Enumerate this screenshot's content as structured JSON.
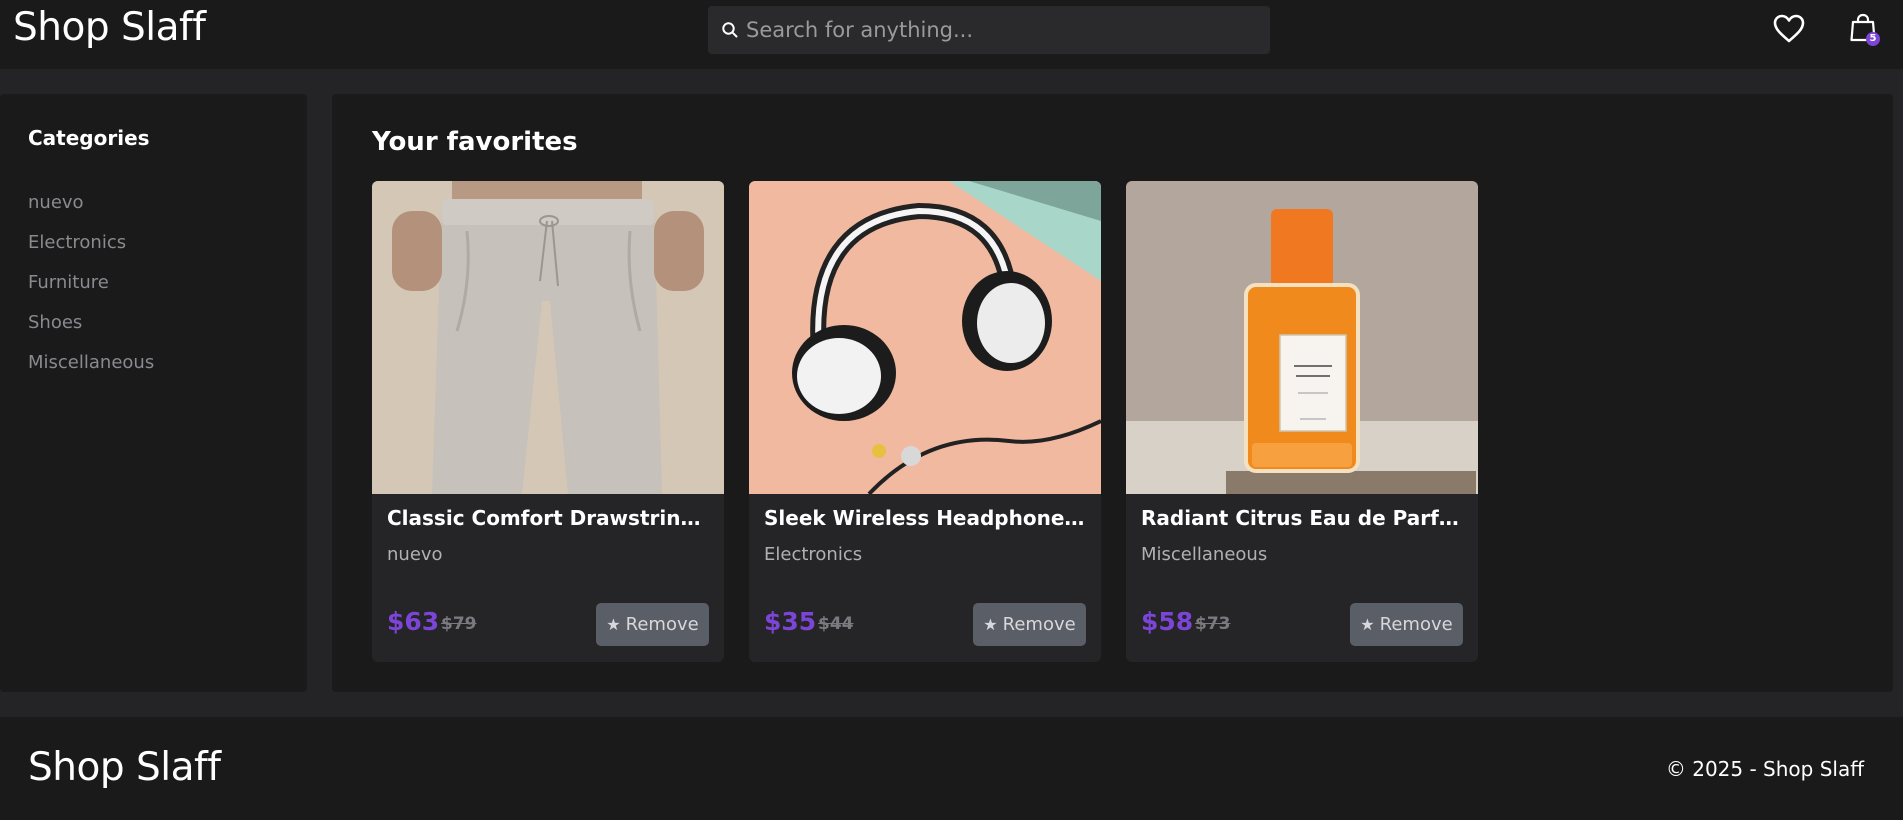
{
  "brand": {
    "name": "Shop Slaff"
  },
  "search": {
    "placeholder": "Search for anything..."
  },
  "header": {
    "cart_count": "5"
  },
  "sidebar": {
    "title": "Categories",
    "items": [
      {
        "label": "nuevo"
      },
      {
        "label": "Electronics"
      },
      {
        "label": "Furniture"
      },
      {
        "label": "Shoes"
      },
      {
        "label": "Miscellaneous"
      }
    ]
  },
  "main": {
    "title": "Your favorites",
    "products": [
      {
        "name": "Classic Comfort Drawstring Joggers",
        "category": "nuevo",
        "price": "$63",
        "old_price": "$79",
        "remove_label": "Remove"
      },
      {
        "name": "Sleek Wireless Headphone & Inked Earbud Set",
        "category": "Electronics",
        "price": "$35",
        "old_price": "$44",
        "remove_label": "Remove"
      },
      {
        "name": "Radiant Citrus Eau de Parfum",
        "category": "Miscellaneous",
        "price": "$58",
        "old_price": "$73",
        "remove_label": "Remove"
      }
    ]
  },
  "footer": {
    "logo": "Shop Slaff",
    "copyright": "© 2025 - Shop Slaff"
  },
  "colors": {
    "accent": "#7c45d8",
    "surface": "#1a1a1b",
    "background": "#242426"
  }
}
